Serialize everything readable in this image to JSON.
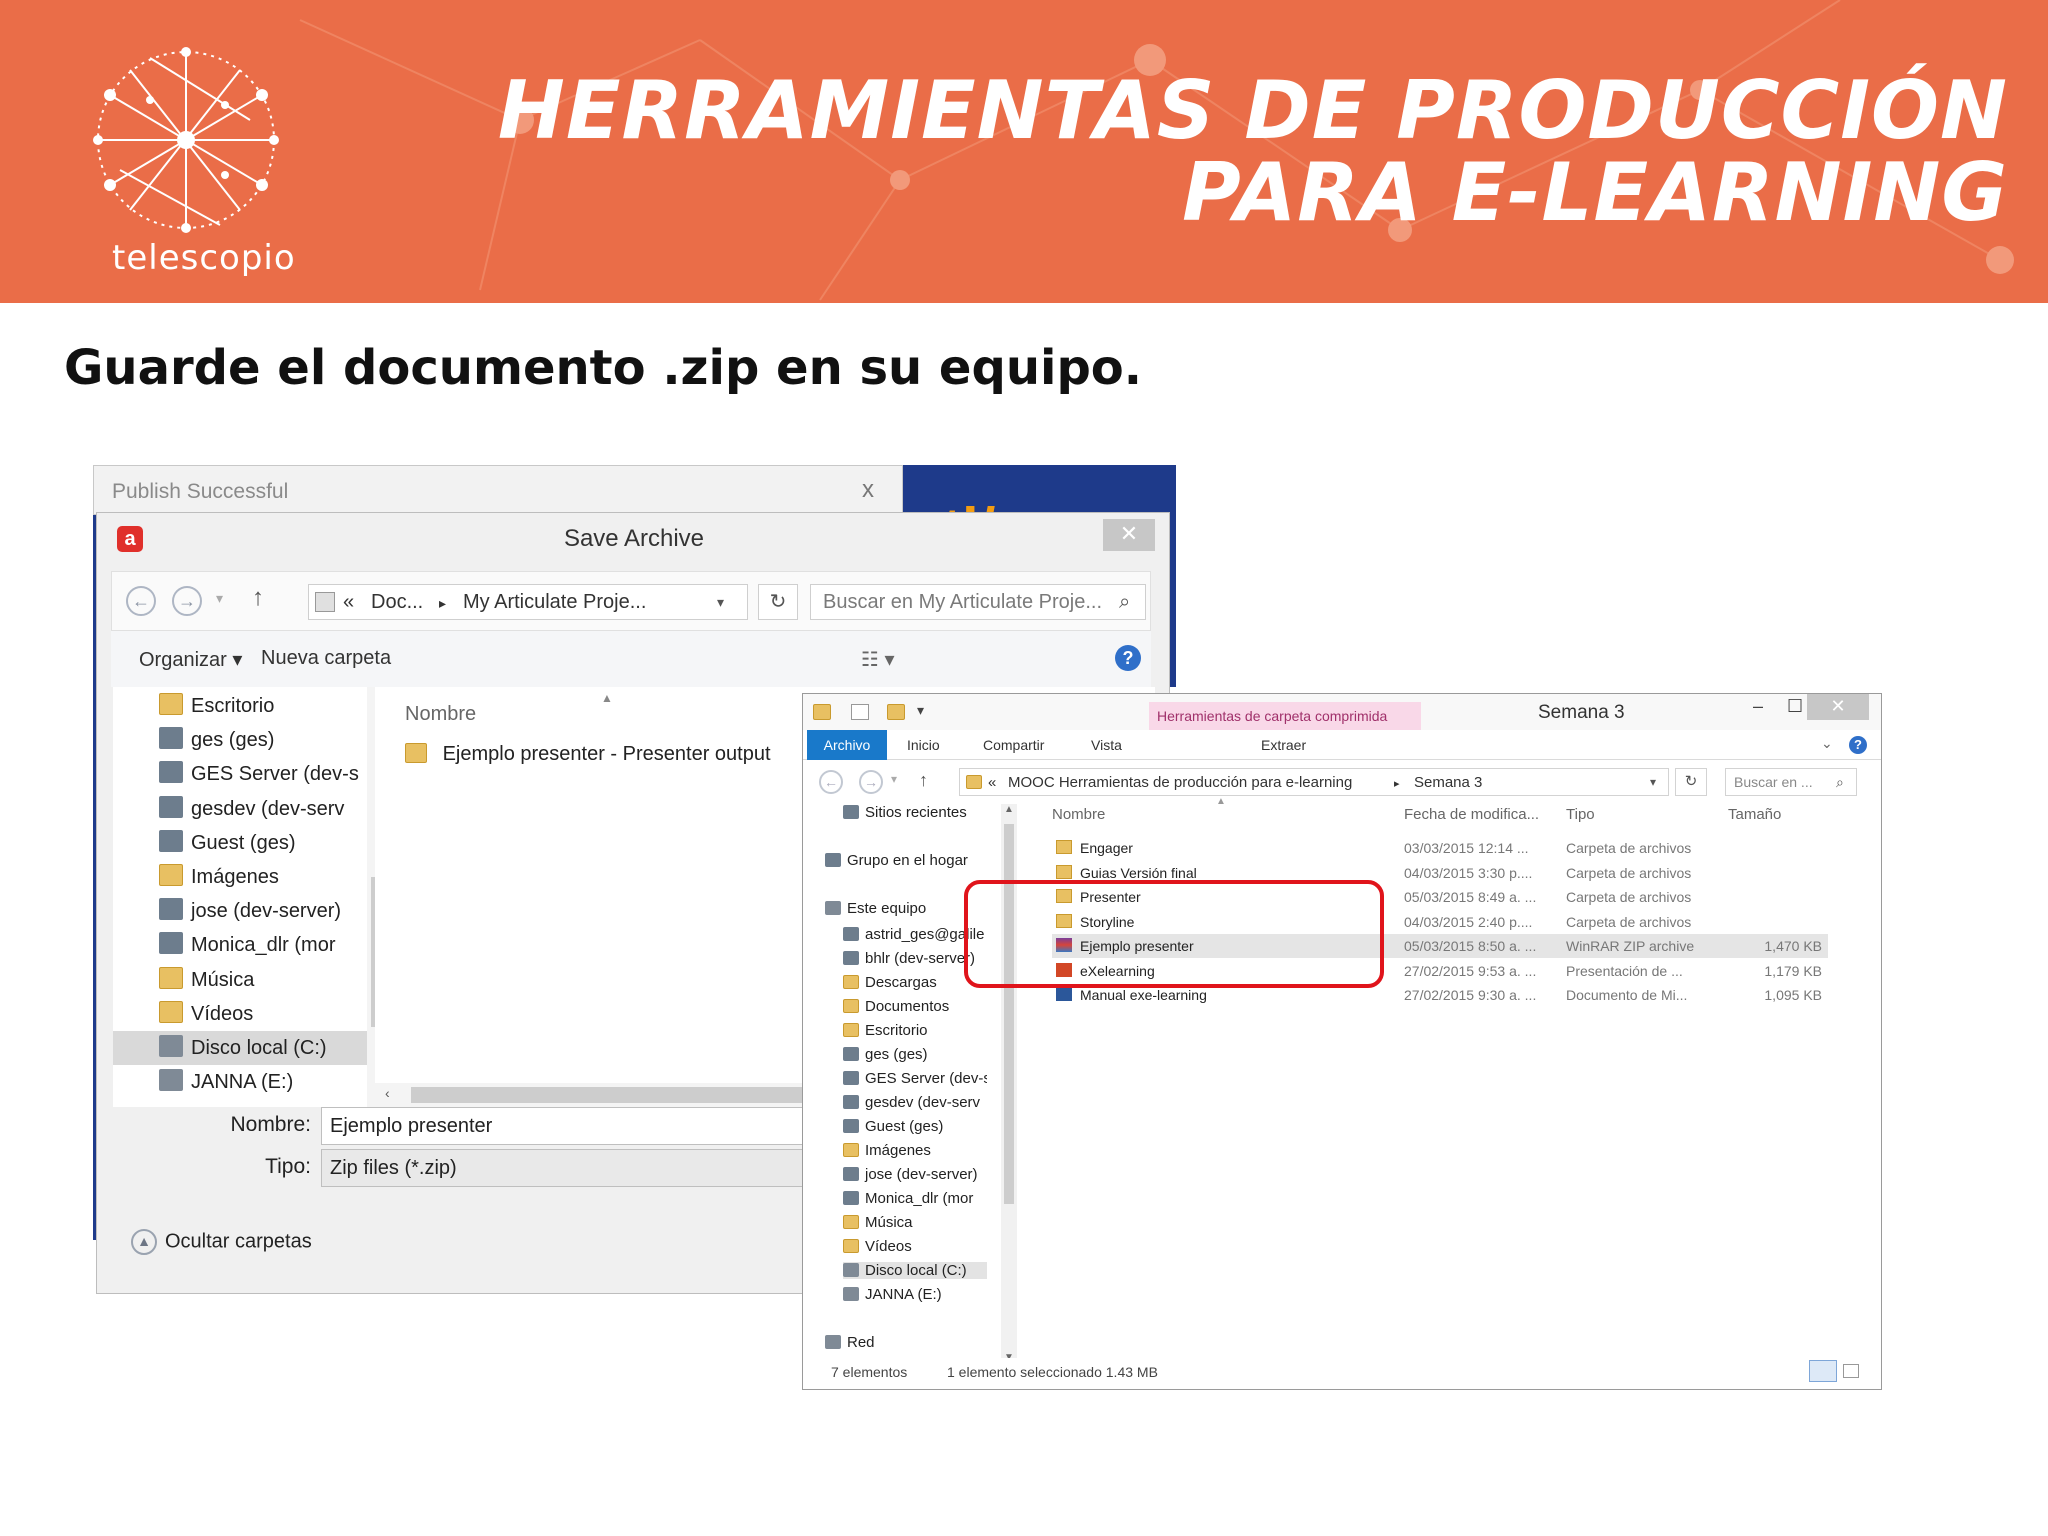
{
  "banner": {
    "logo_text": "telescopio",
    "title_line1": "HERRAMIENTAS DE PRODUCCIÓN",
    "title_line2": "PARA E-LEARNING",
    "color": "#ea6d48"
  },
  "heading": "Guarde el documento .zip en su equipo.",
  "publish_window": {
    "title": "Publish Successful",
    "close": "x"
  },
  "save_dialog": {
    "title": "Save Archive",
    "close": "✕",
    "address_parts": [
      "«",
      "Doc...",
      "▸",
      "My Articulate Proje..."
    ],
    "search_placeholder": "Buscar en My Articulate Proje...",
    "toolbar": {
      "organize": "Organizar ▾",
      "new_folder": "Nueva carpeta",
      "help": "?"
    },
    "nav_items": [
      {
        "label": "Escritorio",
        "icon": "folder"
      },
      {
        "label": "ges (ges)",
        "icon": "netdrv"
      },
      {
        "label": "GES Server (dev-s",
        "icon": "netdrv"
      },
      {
        "label": "gesdev (dev-serv",
        "icon": "netdrv"
      },
      {
        "label": "Guest (ges)",
        "icon": "netdrv"
      },
      {
        "label": "Imágenes",
        "icon": "folder"
      },
      {
        "label": "jose (dev-server)",
        "icon": "netdrv"
      },
      {
        "label": "Monica_dlr (mor",
        "icon": "netdrv"
      },
      {
        "label": "Música",
        "icon": "folder"
      },
      {
        "label": "Vídeos",
        "icon": "folder"
      },
      {
        "label": "Disco local (C:)",
        "icon": "drive"
      },
      {
        "label": "JANNA (E:)",
        "icon": "drive"
      }
    ],
    "columns": {
      "name": "Nombre",
      "date": "Fecha de modifica",
      "type": "Tipo"
    },
    "files": [
      {
        "name": "Ejemplo presenter - Presenter output"
      }
    ],
    "name_label": "Nombre:",
    "name_value": "Ejemplo presenter",
    "type_label": "Tipo:",
    "type_value": "Zip files (*.zip)",
    "hide_folders": "Ocultar carpetas"
  },
  "explorer": {
    "context_tab": "Herramientas de carpeta comprimida",
    "title": "Semana 3",
    "tabs": [
      "Archivo",
      "Inicio",
      "Compartir",
      "Vista",
      "Extraer"
    ],
    "address_parts": [
      "«",
      "MOOC Herramientas de producción para e-learning",
      "▸",
      "Semana 3"
    ],
    "search_placeholder": "Buscar en ...",
    "nav_items": [
      {
        "label": "Sitios recientes",
        "icon": "recent",
        "level": 1
      },
      {
        "label": "Grupo en el hogar",
        "icon": "home",
        "level": 0
      },
      {
        "label": "Este equipo",
        "icon": "pc",
        "level": 0
      },
      {
        "label": "astrid_ges@galile",
        "icon": "netdrv",
        "level": 1
      },
      {
        "label": "bhlr (dev-server)",
        "icon": "netdrv",
        "level": 1
      },
      {
        "label": "Descargas",
        "icon": "folder",
        "level": 1
      },
      {
        "label": "Documentos",
        "icon": "folder",
        "level": 1
      },
      {
        "label": "Escritorio",
        "icon": "folder",
        "level": 1
      },
      {
        "label": "ges (ges)",
        "icon": "netdrv",
        "level": 1
      },
      {
        "label": "GES Server (dev-s",
        "icon": "netdrv",
        "level": 1
      },
      {
        "label": "gesdev (dev-serv",
        "icon": "netdrv",
        "level": 1
      },
      {
        "label": "Guest (ges)",
        "icon": "netdrv",
        "level": 1
      },
      {
        "label": "Imágenes",
        "icon": "folder",
        "level": 1
      },
      {
        "label": "jose (dev-server)",
        "icon": "netdrv",
        "level": 1
      },
      {
        "label": "Monica_dlr (mor",
        "icon": "netdrv",
        "level": 1
      },
      {
        "label": "Música",
        "icon": "folder",
        "level": 1
      },
      {
        "label": "Vídeos",
        "icon": "folder",
        "level": 1
      },
      {
        "label": "Disco local (C:)",
        "icon": "drive",
        "level": 1
      },
      {
        "label": "JANNA (E:)",
        "icon": "drive",
        "level": 1
      },
      {
        "label": "Red",
        "icon": "network",
        "level": 0
      }
    ],
    "columns": {
      "name": "Nombre",
      "date": "Fecha de modifica...",
      "type": "Tipo",
      "size": "Tamaño"
    },
    "rows": [
      {
        "name": "Engager",
        "date": "03/03/2015 12:14 ...",
        "type": "Carpeta de archivos",
        "size": "",
        "icon": "folder"
      },
      {
        "name": "Guias Versión final",
        "date": "04/03/2015 3:30 p....",
        "type": "Carpeta de archivos",
        "size": "",
        "icon": "folder"
      },
      {
        "name": "Presenter",
        "date": "05/03/2015 8:49 a. ...",
        "type": "Carpeta de archivos",
        "size": "",
        "icon": "folder"
      },
      {
        "name": "Storyline",
        "date": "04/03/2015 2:40 p....",
        "type": "Carpeta de archivos",
        "size": "",
        "icon": "folder"
      },
      {
        "name": "Ejemplo presenter",
        "date": "05/03/2015 8:50 a. ...",
        "type": "WinRAR ZIP archive",
        "size": "1,470 KB",
        "icon": "zip"
      },
      {
        "name": "eXelearning",
        "date": "27/02/2015 9:53 a. ...",
        "type": "Presentación de ...",
        "size": "1,179 KB",
        "icon": "ppt"
      },
      {
        "name": "Manual exe-learning",
        "date": "27/02/2015 9:30 a. ...",
        "type": "Documento de Mi...",
        "size": "1,095 KB",
        "icon": "doc"
      }
    ],
    "status_count": "7 elementos",
    "status_selected": "1 elemento seleccionado  1.43 MB"
  }
}
